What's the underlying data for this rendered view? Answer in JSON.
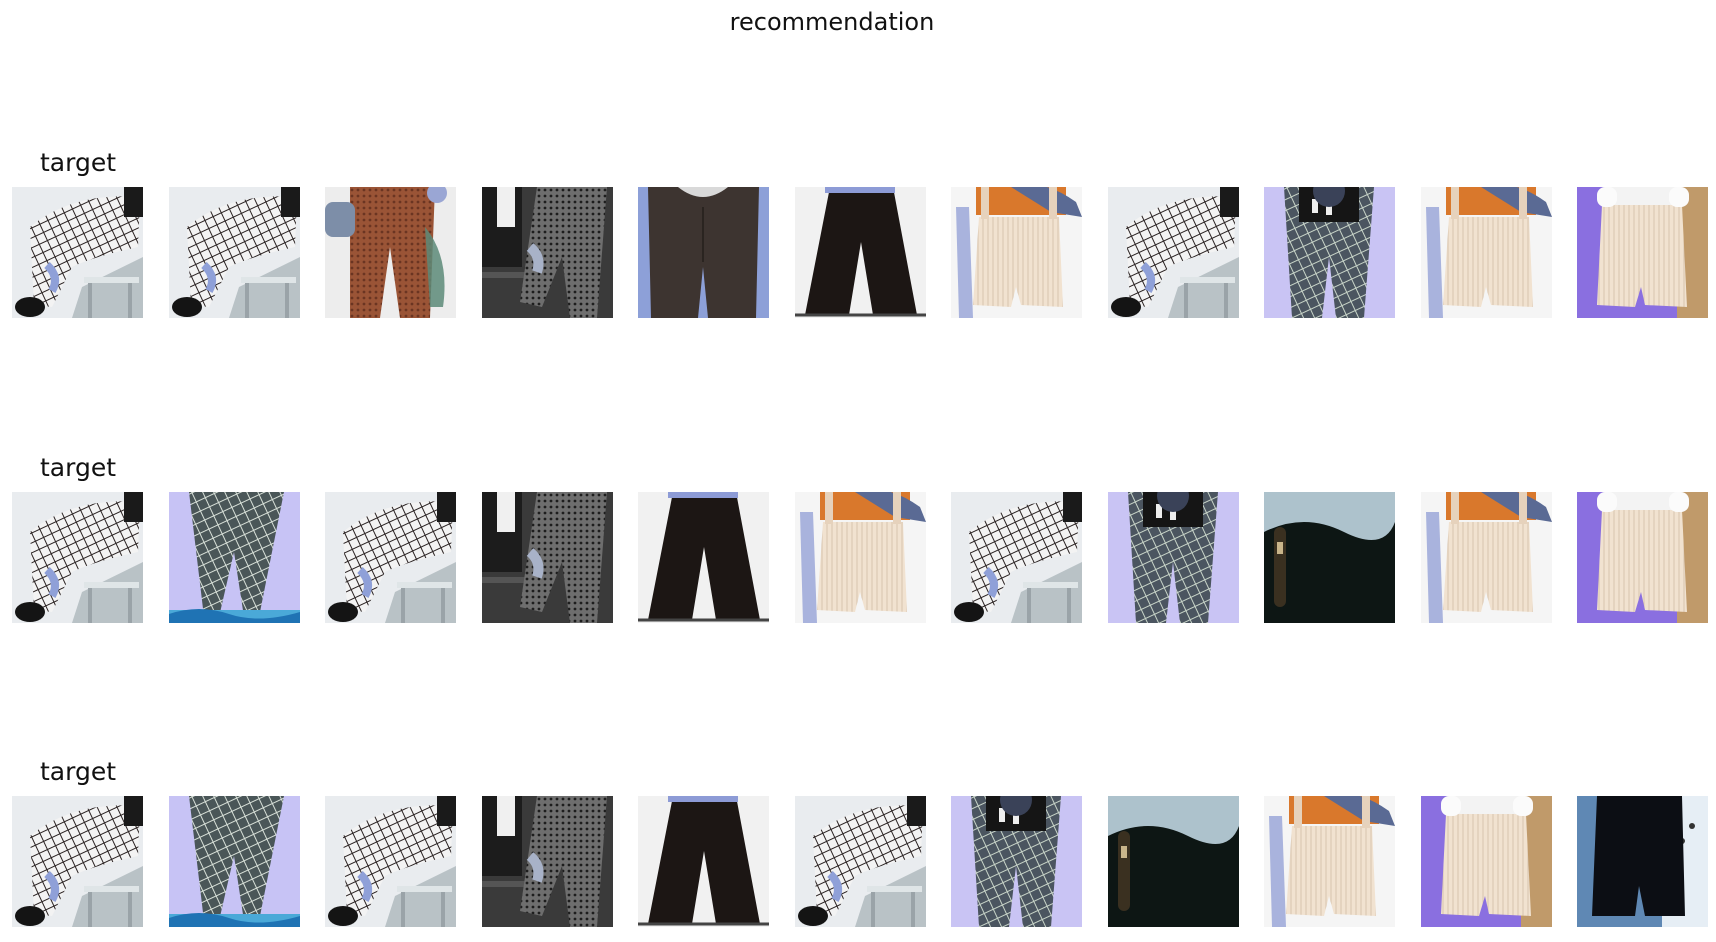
{
  "figure": {
    "title": "recommendation"
  },
  "rows": [
    {
      "label": "target",
      "images": [
        "checked-pants-chair",
        "checked-pants-chair",
        "brown-pants-bag",
        "houndstooth-pants",
        "dark-jeans",
        "black-wide-pants",
        "cream-overalls",
        "checked-pants-chair",
        "plaid-pants-lavender",
        "cream-overalls",
        "cream-overalls-purple"
      ]
    },
    {
      "label": "target",
      "images": [
        "checked-pants-chair",
        "plaid-pants-legs",
        "checked-pants-chair",
        "houndstooth-pants",
        "black-wide-pants",
        "cream-overalls",
        "checked-pants-chair",
        "plaid-pants-lavender",
        "dark-velvet-skirt",
        "cream-overalls",
        "cream-overalls-purple"
      ]
    },
    {
      "label": "target",
      "images": [
        "checked-pants-chair",
        "plaid-pants-legs",
        "checked-pants-chair",
        "houndstooth-pants",
        "black-wide-pants",
        "checked-pants-chair",
        "plaid-pants-lavender",
        "dark-velvet-skirt",
        "cream-overalls",
        "cream-overalls-purple",
        "black-shorts-blue"
      ]
    }
  ]
}
